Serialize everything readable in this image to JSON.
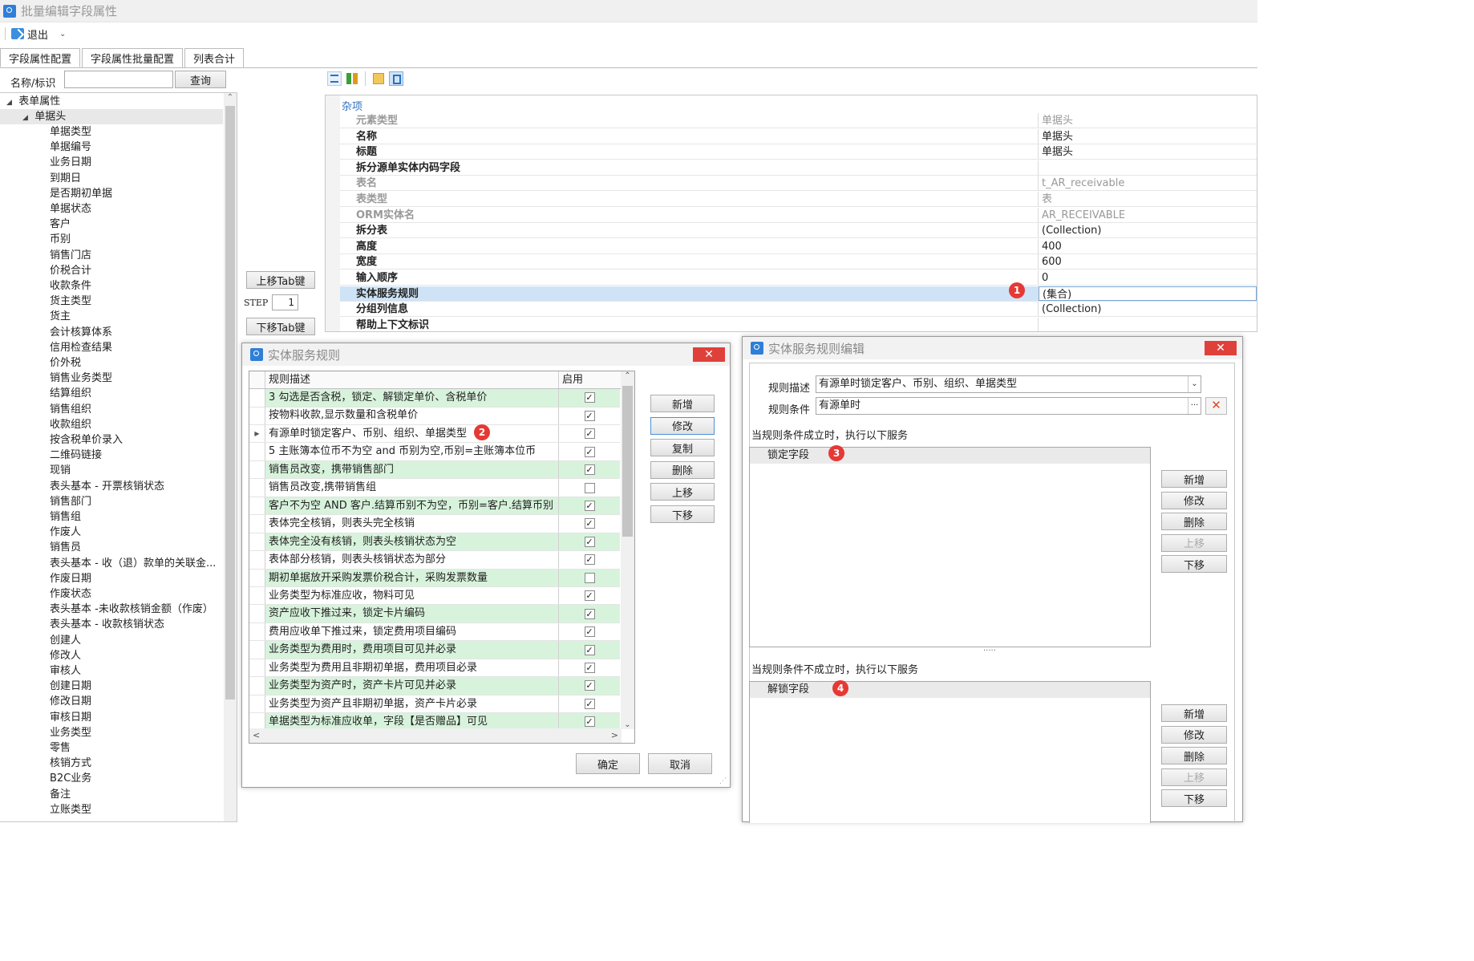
{
  "window": {
    "title": "批量编辑字段属性"
  },
  "toolbar": {
    "exit_label": "退出"
  },
  "tabs": [
    "字段属性配置",
    "字段属性批量配置",
    "列表合计"
  ],
  "search": {
    "label": "名称/标识",
    "value": "",
    "button": "查询"
  },
  "tree": {
    "root": "表单属性",
    "node": "单据头",
    "items": [
      "单据类型",
      "单据编号",
      "业务日期",
      "到期日",
      "是否期初单据",
      "单据状态",
      "客户",
      "币别",
      "销售门店",
      "价税合计",
      "收款条件",
      "货主类型",
      "货主",
      "会计核算体系",
      "信用检查结果",
      "价外税",
      "销售业务类型",
      "结算组织",
      "销售组织",
      "收款组织",
      "按含税单价录入",
      "二维码链接",
      "现销",
      "表头基本 - 开票核销状态",
      "销售部门",
      "销售组",
      "作废人",
      "销售员",
      "表头基本 - 收（退）款单的关联金...",
      "作废日期",
      "作废状态",
      "表头基本 -未收款核销金额（作废）",
      "表头基本 - 收款核销状态",
      "创建人",
      "修改人",
      "审核人",
      "创建日期",
      "修改日期",
      "审核日期",
      "业务类型",
      "零售",
      "核销方式",
      "B2C业务",
      "备注",
      "立账类型"
    ]
  },
  "tab_order": {
    "up_button": "上移Tab键",
    "step_label": "STEP",
    "step_value": "1",
    "down_button": "下移Tab键"
  },
  "property_grid": {
    "category": "杂项",
    "rows": [
      {
        "name": "元素类型",
        "value": "单据头",
        "readonly": true
      },
      {
        "name": "名称",
        "value": "单据头",
        "readonly": false
      },
      {
        "name": "标题",
        "value": "单据头",
        "readonly": false
      },
      {
        "name": "拆分源单实体内码字段",
        "value": "",
        "readonly": false
      },
      {
        "name": "表名",
        "value": "t_AR_receivable",
        "readonly": true
      },
      {
        "name": "表类型",
        "value": "表",
        "readonly": true
      },
      {
        "name": "ORM实体名",
        "value": "AR_RECEIVABLE",
        "readonly": true
      },
      {
        "name": "拆分表",
        "value": "(Collection)",
        "readonly": false
      },
      {
        "name": "高度",
        "value": "400",
        "readonly": false
      },
      {
        "name": "宽度",
        "value": "600",
        "readonly": false
      },
      {
        "name": "输入顺序",
        "value": "0",
        "readonly": false
      },
      {
        "name": "实体服务规则",
        "value": "(集合)",
        "readonly": false,
        "selected": true
      },
      {
        "name": "分组列信息",
        "value": "(Collection)",
        "readonly": false
      },
      {
        "name": "帮助上下文标识",
        "value": "",
        "readonly": false
      }
    ]
  },
  "badges": [
    "1",
    "2",
    "3",
    "4"
  ],
  "rules_dialog": {
    "title": "实体服务规则",
    "col_desc": "规则描述",
    "col_enabled": "启用",
    "rows": [
      {
        "desc": "3 勾选是否含税，锁定、解锁定单价、含税单价",
        "enabled": true,
        "green": true
      },
      {
        "desc": "按物料收款,显示数量和含税单价",
        "enabled": true,
        "green": false
      },
      {
        "desc": "有源单时锁定客户、币别、组织、单据类型",
        "enabled": true,
        "green": false,
        "current": true
      },
      {
        "desc": "5 主账簿本位币不为空 and 币别为空,币别=主账簿本位币",
        "enabled": true,
        "green": false
      },
      {
        "desc": "销售员改变，携带销售部门",
        "enabled": true,
        "green": true
      },
      {
        "desc": "销售员改变,携带销售组",
        "enabled": false,
        "green": false
      },
      {
        "desc": "客户不为空 AND 客户.结算币别不为空，币别=客户.结算币别",
        "enabled": true,
        "green": true
      },
      {
        "desc": "表体完全核销，则表头完全核销",
        "enabled": true,
        "green": false
      },
      {
        "desc": "表体完全没有核销，则表头核销状态为空",
        "enabled": true,
        "green": true
      },
      {
        "desc": "表体部分核销，则表头核销状态为部分",
        "enabled": true,
        "green": false
      },
      {
        "desc": "期初单据放开采购发票价税合计，采购发票数量",
        "enabled": false,
        "green": true
      },
      {
        "desc": "业务类型为标准应收，物料可见",
        "enabled": true,
        "green": false
      },
      {
        "desc": "资产应收下推过来，锁定卡片编码",
        "enabled": true,
        "green": true
      },
      {
        "desc": "费用应收单下推过来，锁定费用项目编码",
        "enabled": true,
        "green": false
      },
      {
        "desc": "业务类型为费用时，费用项目可见并必录",
        "enabled": true,
        "green": true
      },
      {
        "desc": "业务类型为费用且非期初单据，费用项目必录",
        "enabled": true,
        "green": false
      },
      {
        "desc": "业务类型为资产时，资产卡片可见并必录",
        "enabled": true,
        "green": true
      },
      {
        "desc": "业务类型为资产且非期初单据，资产卡片必录",
        "enabled": true,
        "green": false
      },
      {
        "desc": "单据类型为标准应收单，字段【是否赠品】可见",
        "enabled": true,
        "green": true
      }
    ],
    "side_buttons": [
      "新增",
      "修改",
      "复制",
      "删除",
      "上移",
      "下移"
    ],
    "ok": "确定",
    "cancel": "取消"
  },
  "rule_edit_dialog": {
    "title": "实体服务规则编辑",
    "desc_label": "规则描述",
    "desc_value": "有源单时锁定客户、币别、组织、单据类型",
    "cond_label": "规则条件",
    "cond_value": "有源单时",
    "ellipsis": "···",
    "true_caption": "当规则条件成立时，执行以下服务",
    "true_panel": "锁定字段",
    "false_caption": "当规则条件不成立时，执行以下服务",
    "false_panel": "解锁字段",
    "splitter": "·····",
    "buttons": [
      "新增",
      "修改",
      "删除",
      "上移",
      "下移"
    ]
  }
}
